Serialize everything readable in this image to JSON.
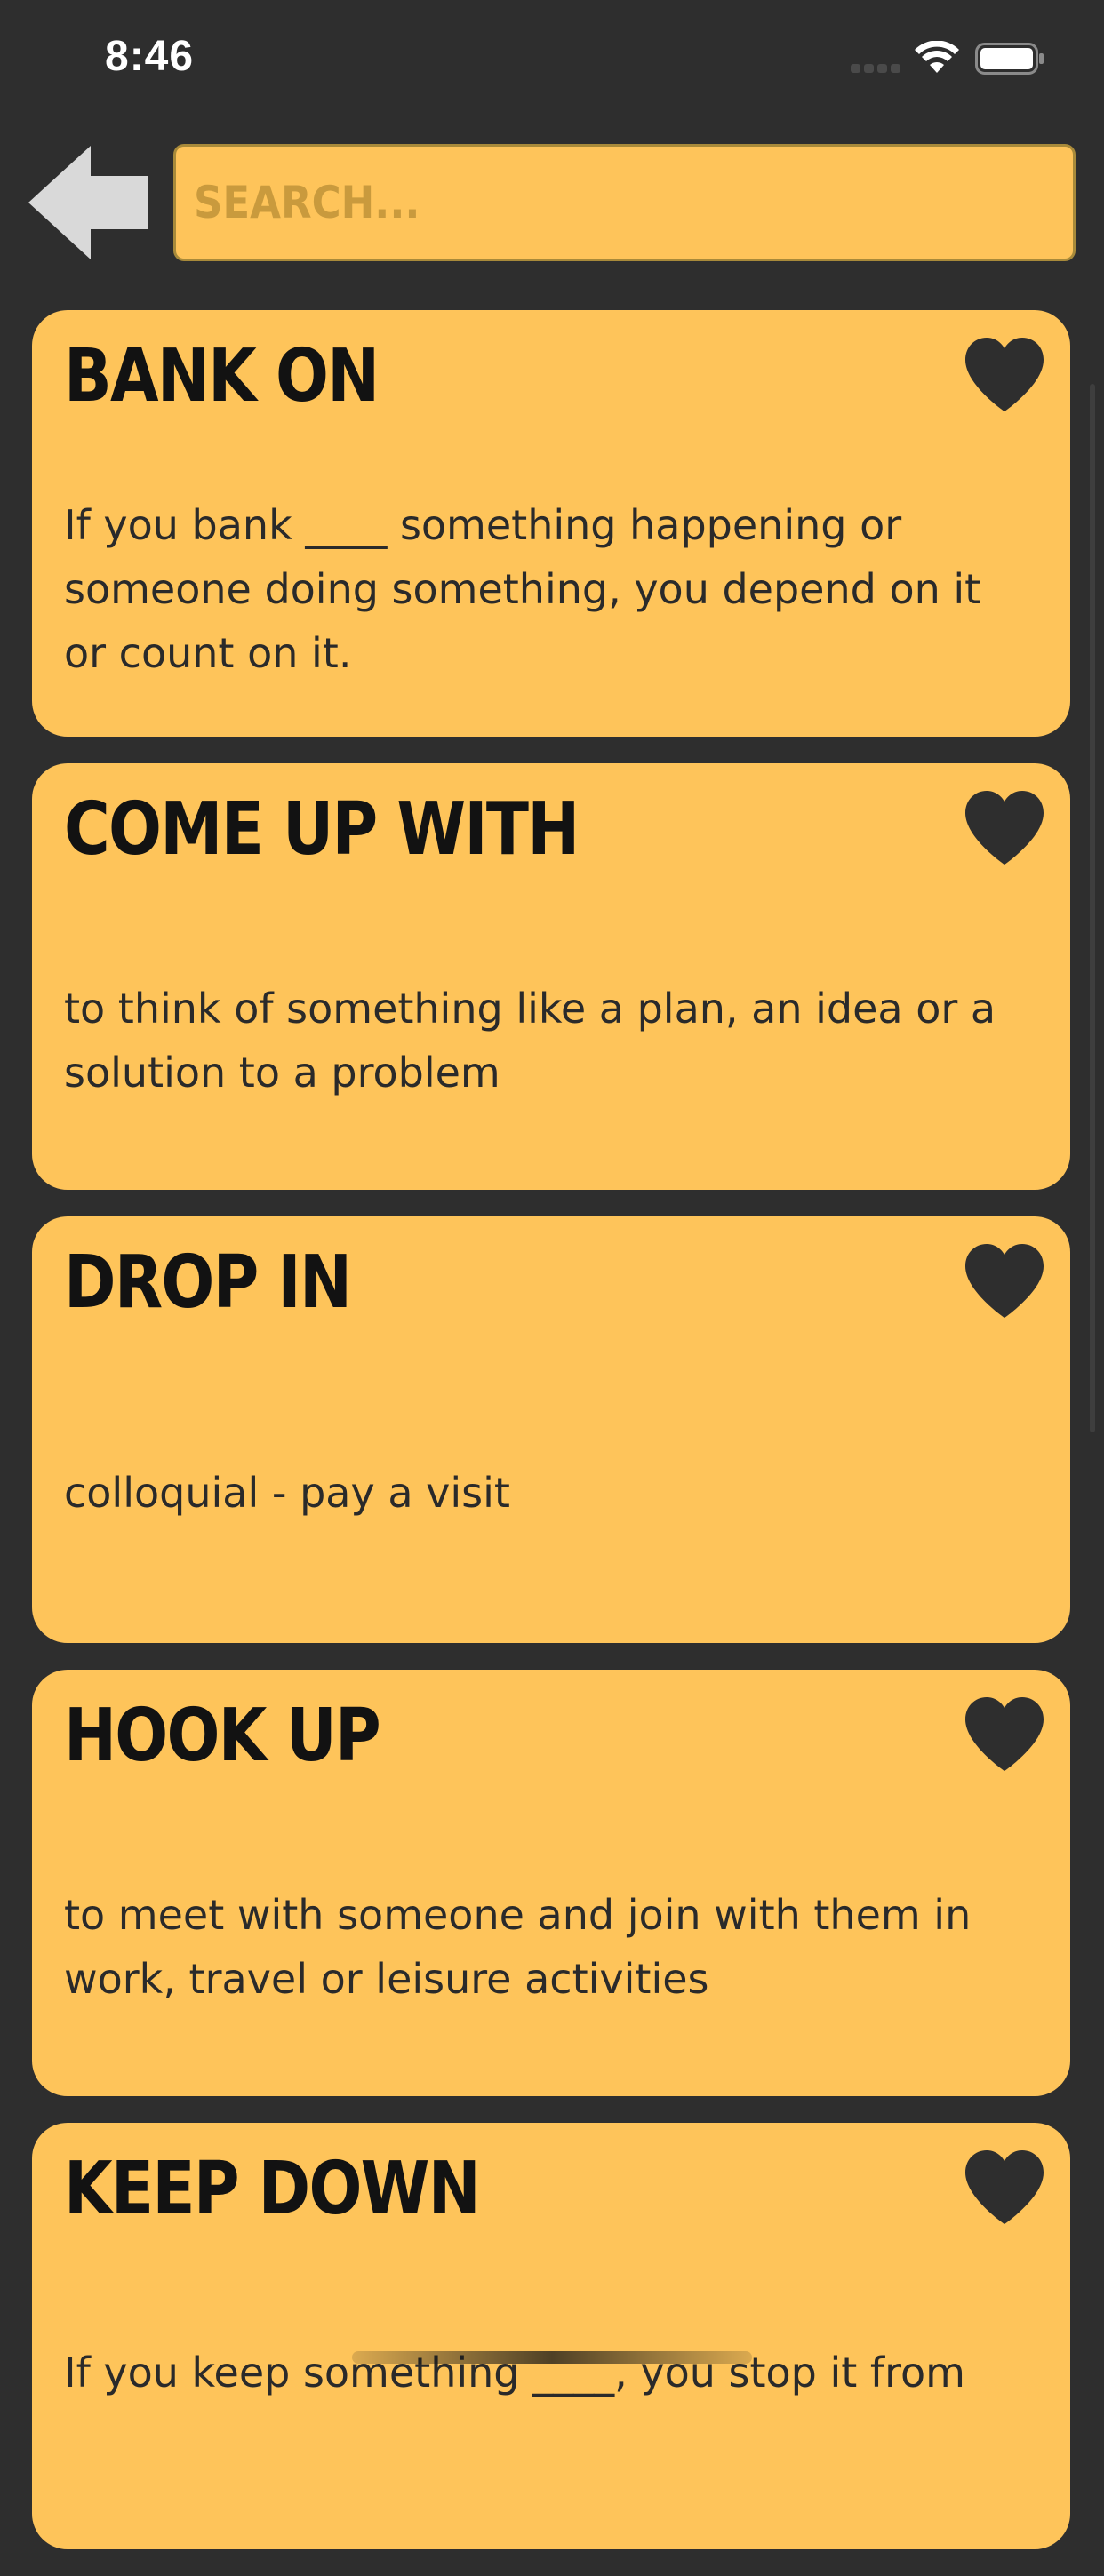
{
  "status_bar": {
    "time": "8:46",
    "icons": [
      "cellular-signal-icon",
      "wifi-icon",
      "battery-icon"
    ]
  },
  "header": {
    "back_icon": "arrow-left-icon",
    "search": {
      "placeholder": "SEARCH...",
      "value": ""
    }
  },
  "colors": {
    "background": "#2e2e2e",
    "card": "#fec45a",
    "heart": "#2e2e2e",
    "title_text": "#121212",
    "body_text": "#2a2a2a"
  },
  "cards": [
    {
      "title": "BANK ON",
      "description": "If you bank ____ something happening or someone doing something, you depend on it or count on it.",
      "favorite_icon": "heart-icon"
    },
    {
      "title": "COME UP WITH",
      "description": "to think of something like a plan, an idea or a solution to a problem",
      "favorite_icon": "heart-icon"
    },
    {
      "title": "DROP IN",
      "description": "colloquial - pay a visit",
      "favorite_icon": "heart-icon"
    },
    {
      "title": "HOOK UP",
      "description": "to meet with someone and join with them in work, travel or leisure activities",
      "favorite_icon": "heart-icon"
    },
    {
      "title": "KEEP DOWN",
      "description": "If you keep something ____, you stop it from",
      "favorite_icon": "heart-icon"
    }
  ]
}
